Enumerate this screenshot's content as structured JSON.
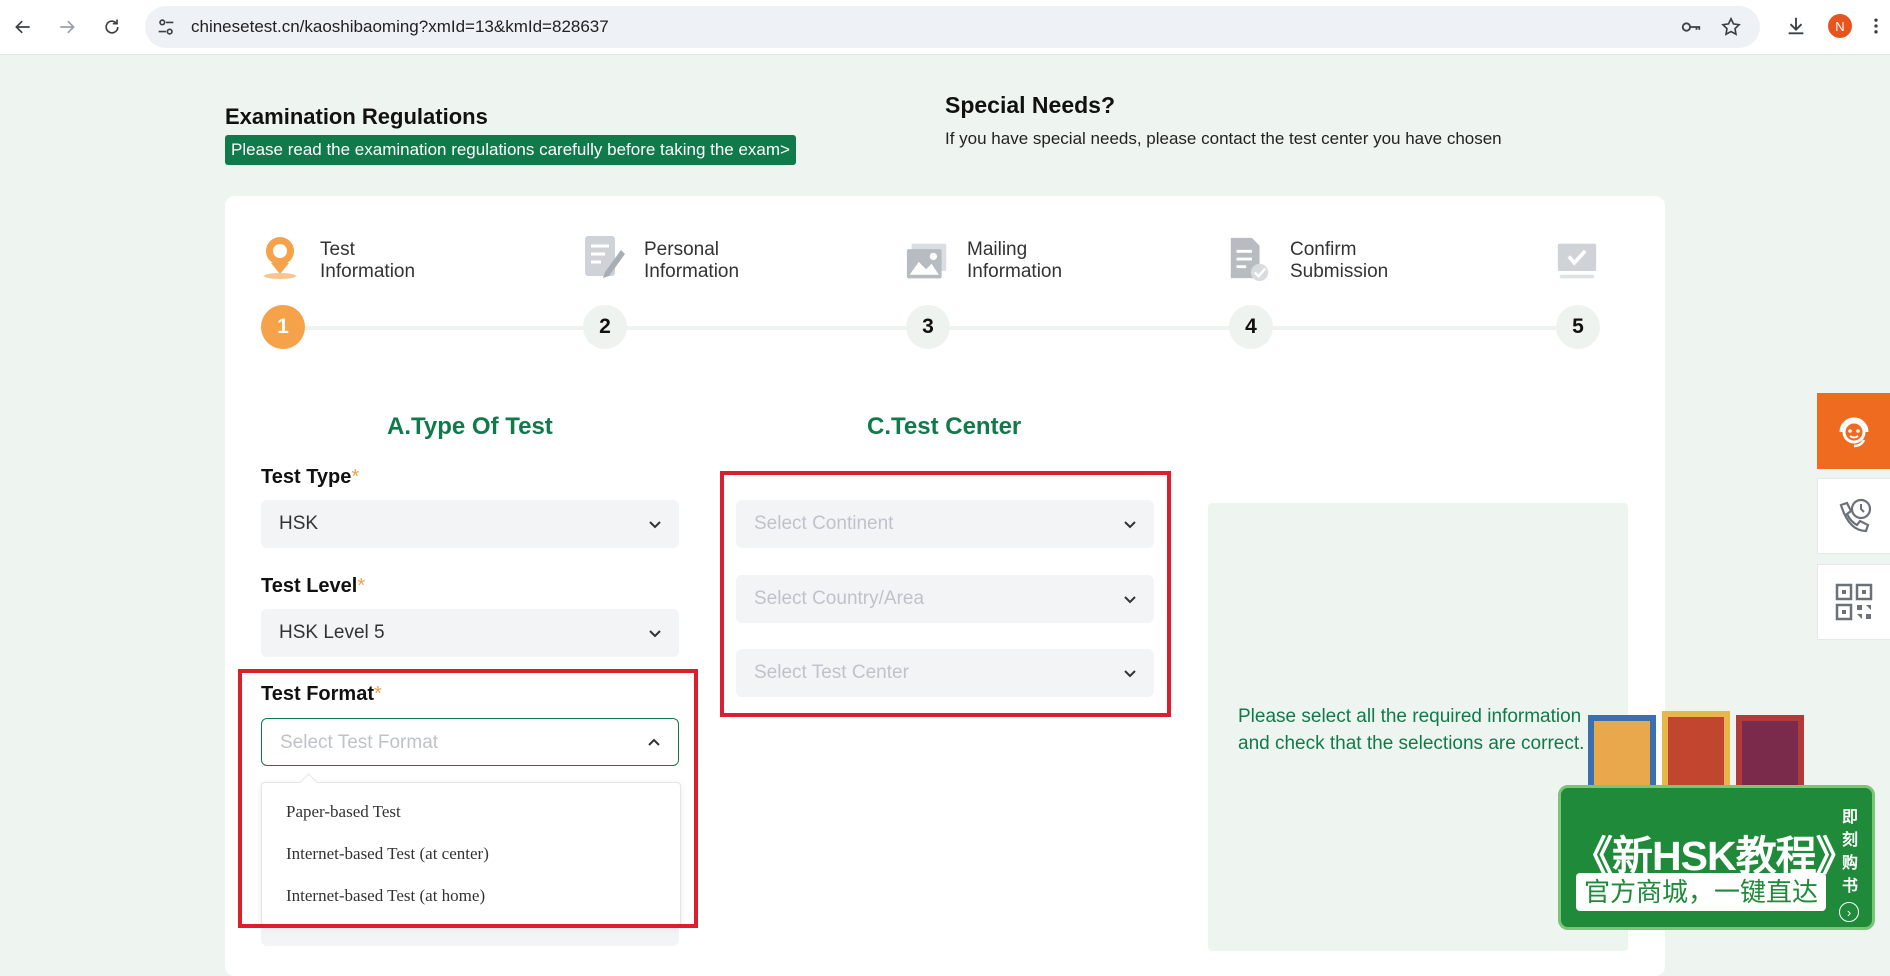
{
  "browser": {
    "url": "chinesetest.cn/kaoshibaoming?xmId=13&kmId=828637",
    "avatar_letter": "N"
  },
  "header": {
    "regulations_title": "Examination Regulations",
    "regulations_banner": "Please read the examination regulations carefully before taking the exam>",
    "special_needs_title": "Special Needs?",
    "special_needs_text": "If you have special needs, please contact the test center you have chosen"
  },
  "steps": [
    {
      "number": "1",
      "line1": "Test",
      "line2": "Information",
      "icon": "location-pin-icon",
      "active": true
    },
    {
      "number": "2",
      "line1": "Personal",
      "line2": "Information",
      "icon": "edit-form-icon",
      "active": false
    },
    {
      "number": "3",
      "line1": "Mailing",
      "line2": "Information",
      "icon": "image-icon",
      "active": false
    },
    {
      "number": "4",
      "line1": "Confirm",
      "line2": "Submission",
      "icon": "document-check-icon",
      "active": false
    },
    {
      "number": "5",
      "line1": "",
      "line2": "",
      "icon": "monitor-check-icon",
      "active": false
    }
  ],
  "section_a": {
    "title": "A.Type Of Test",
    "test_type": {
      "label": "Test Type",
      "required": "*",
      "value": "HSK"
    },
    "test_level": {
      "label": "Test Level",
      "required": "*",
      "value": "HSK Level 5"
    },
    "test_format": {
      "label": "Test Format",
      "required": "*",
      "placeholder": "Select Test Format",
      "options": [
        "Paper-based Test",
        "Internet-based Test (at center)",
        "Internet-based Test (at home)"
      ]
    }
  },
  "section_c": {
    "title": "C.Test Center",
    "continent_placeholder": "Select Continent",
    "country_placeholder": "Select Country/Area",
    "center_placeholder": "Select Test Center"
  },
  "summary": {
    "text": "Please select all the required information and check that the selections are correct."
  },
  "ad": {
    "title": "《新HSK教程》",
    "subtitle": "官方商城，一键直达",
    "buy_label": "即刻购书"
  },
  "colors": {
    "brand_green": "#117a4a",
    "active_step": "#f6a24a",
    "highlight_red": "#dc1f2d",
    "support_orange": "#ef6b1f"
  }
}
